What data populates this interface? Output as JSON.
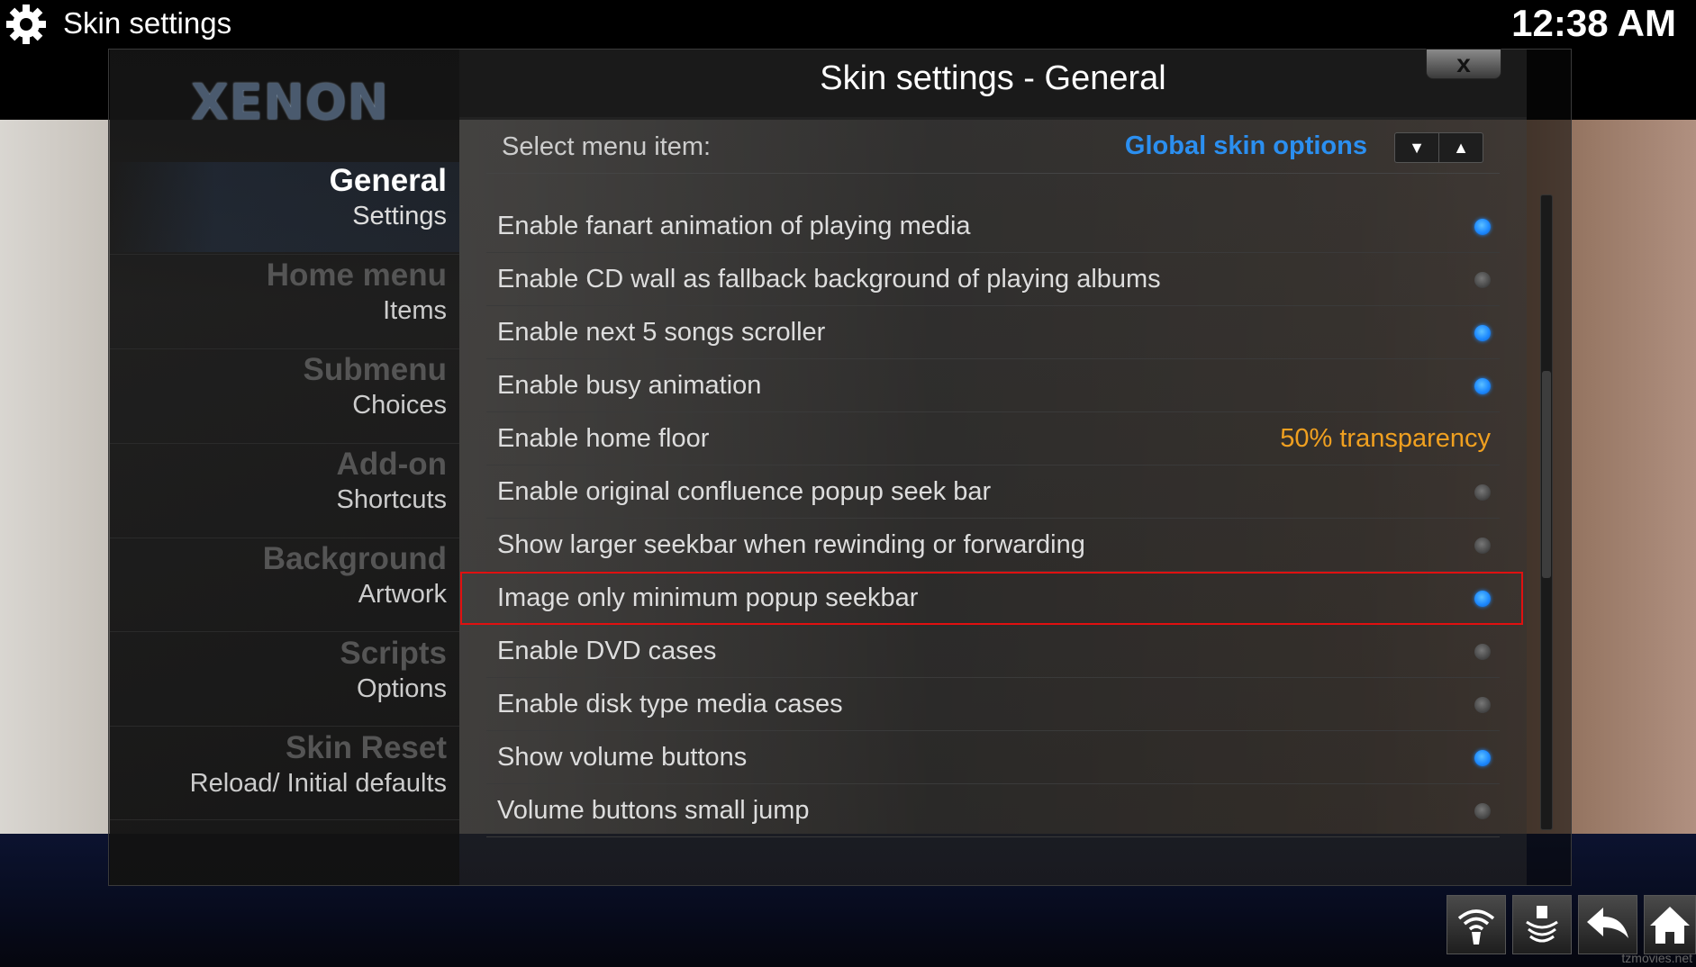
{
  "topbar": {
    "title": "Skin settings",
    "clock": "12:38 AM",
    "icon": "gear-icon"
  },
  "dialog": {
    "logo": "XENON",
    "title": "Skin settings - General",
    "close_label": "x"
  },
  "sidebar": {
    "items": [
      {
        "title": "General",
        "subtitle": "Settings",
        "active": true
      },
      {
        "title": "Home menu",
        "subtitle": "Items",
        "active": false
      },
      {
        "title": "Submenu",
        "subtitle": "Choices",
        "active": false
      },
      {
        "title": "Add-on",
        "subtitle": "Shortcuts",
        "active": false
      },
      {
        "title": "Background",
        "subtitle": "Artwork",
        "active": false
      },
      {
        "title": "Scripts",
        "subtitle": "Options",
        "active": false
      },
      {
        "title": "Skin Reset",
        "subtitle": "Reload/ Initial defaults",
        "active": false
      }
    ]
  },
  "select": {
    "label": "Select menu item:",
    "value": "Global skin options",
    "down_icon": "triangle-down-icon",
    "up_icon": "triangle-up-icon"
  },
  "settings": [
    {
      "label": "Enable fanart animation of playing media",
      "state": "on"
    },
    {
      "label": "Enable CD wall as fallback background of playing albums",
      "state": "off"
    },
    {
      "label": "Enable next 5 songs scroller",
      "state": "on"
    },
    {
      "label": "Enable busy animation",
      "state": "on"
    },
    {
      "label": "Enable home floor",
      "value": "50% transparency"
    },
    {
      "label": "Enable original confluence popup seek bar",
      "state": "off"
    },
    {
      "label": "Show larger seekbar when rewinding or forwarding",
      "state": "off"
    },
    {
      "label": "Image only minimum popup seekbar",
      "state": "on",
      "focused": true
    },
    {
      "label": "Enable DVD cases",
      "state": "off"
    },
    {
      "label": "Enable disk type media cases",
      "state": "off"
    },
    {
      "label": "Show volume buttons",
      "state": "on"
    },
    {
      "label": "Volume buttons small jump",
      "state": "off"
    }
  ],
  "toolbar": [
    "wifi-icon",
    "eject-icon",
    "back-arrow-icon",
    "home-icon"
  ],
  "colors": {
    "accent_blue": "#2b8ff0",
    "toggle_on": "#1e8aff",
    "value_orange": "#f0a020",
    "focus_red": "#e01010"
  },
  "watermark": "tzmovies.net"
}
